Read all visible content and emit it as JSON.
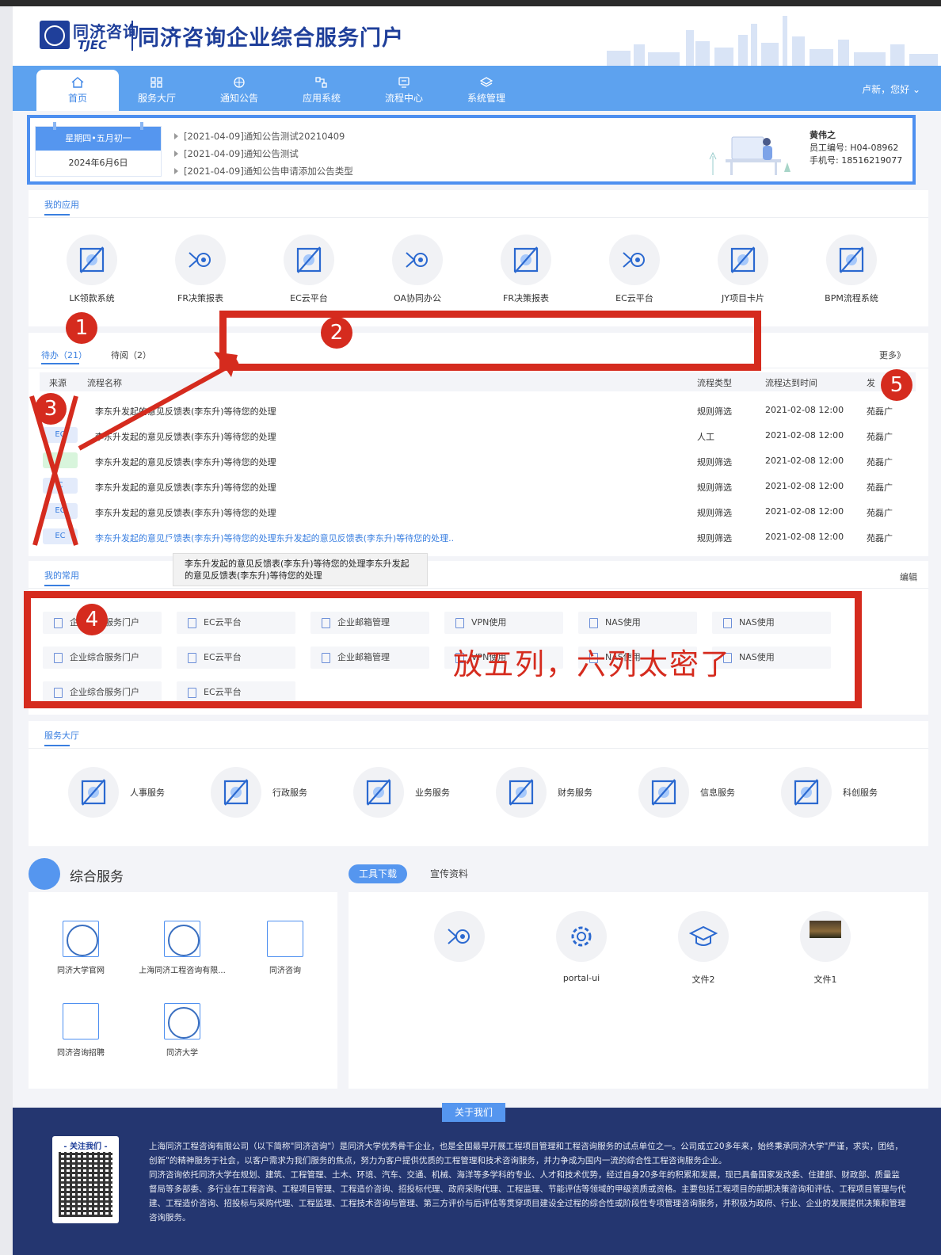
{
  "header": {
    "logo_cn": "同济咨询",
    "logo_en": "TJEC",
    "title": "同济咨询企业综合服务门户"
  },
  "nav": {
    "items": [
      {
        "label": "首页",
        "icon": "home-icon"
      },
      {
        "label": "服务大厅",
        "icon": "grid-icon"
      },
      {
        "label": "通知公告",
        "icon": "globe-icon"
      },
      {
        "label": "应用系统",
        "icon": "apps-icon"
      },
      {
        "label": "流程中心",
        "icon": "flow-icon"
      },
      {
        "label": "系统管理",
        "icon": "layers-icon"
      }
    ],
    "user": "卢新，您好"
  },
  "notice": {
    "weekday": "星期四•五月初一",
    "date": "2024年6月6日",
    "items": [
      "[2021-04-09]通知公告测试20210409",
      "[2021-04-09]通知公告测试",
      "[2021-04-09]通知公告申请添加公告类型"
    ],
    "profile": {
      "name": "黄伟之",
      "emp_no": "员工编号: H04-08962",
      "phone": "手机号: 18516219077"
    }
  },
  "my_apps": {
    "tab": "我的应用",
    "apps": [
      "LK领款系统",
      "FR决策报表",
      "EC云平台",
      "OA协同办公",
      "FR决策报表",
      "EC云平台",
      "JY项目卡片",
      "BPM流程系统"
    ]
  },
  "todo": {
    "tab_todo": "待办（21）",
    "tab_read": "待阅（2）",
    "more": "更多》",
    "headers": {
      "source": "来源",
      "name": "流程名称",
      "type": "流程类型",
      "time": "流程达到时间",
      "initiator": "发"
    },
    "rows": [
      {
        "src": "",
        "name": "李东升发起的意见反馈表(李东升)等待您的处理",
        "type": "规则筛选",
        "time": "2021-02-08 12:00",
        "initiator": "苑磊广"
      },
      {
        "src": "EC",
        "name": "李东升发起的意见反馈表(李东升)等待您的处理",
        "type": "人工",
        "time": "2021-02-08 12:00",
        "initiator": "苑磊广"
      },
      {
        "src": "",
        "name": "李东升发起的意见反馈表(李东升)等待您的处理",
        "type": "规则筛选",
        "time": "2021-02-08 12:00",
        "initiator": "苑磊广"
      },
      {
        "src": "C",
        "name": "李东升发起的意见反馈表(李东升)等待您的处理",
        "type": "规则筛选",
        "time": "2021-02-08 12:00",
        "initiator": "苑磊广"
      },
      {
        "src": "EC",
        "name": "李东升发起的意见反馈表(李东升)等待您的处理",
        "type": "规则筛选",
        "time": "2021-02-08 12:00",
        "initiator": "苑磊广"
      },
      {
        "src": "EC",
        "name": "李东升发起的意见反馈表(李东升)等待您的处理东升发起的意见反馈表(李东升)等待您的处理..",
        "type": "规则筛选",
        "time": "2021-02-08 12:00",
        "initiator": "苑磊广"
      }
    ],
    "tooltip": "李东升发起的意见反馈表(李东升)等待您的处理李东升发起的意见反馈表(李东升)等待您的处理"
  },
  "common": {
    "tab": "我的常用",
    "edit": "编辑",
    "items": [
      "企业综合服务门户",
      "EC云平台",
      "企业邮箱管理",
      "VPN使用",
      "NAS使用",
      "NAS使用",
      "企业综合服务门户",
      "EC云平台",
      "企业邮箱管理",
      "VPN使用",
      "NAS使用",
      "NAS使用",
      "企业综合服务门户",
      "EC云平台"
    ]
  },
  "hall": {
    "tab": "服务大厅",
    "items": [
      "人事服务",
      "行政服务",
      "业务服务",
      "财务服务",
      "信息服务",
      "科创服务"
    ]
  },
  "integrated": {
    "title": "综合服务",
    "tab_active": "工具下载",
    "tab_other": "宣传资料",
    "links": [
      "同济大学官网",
      "上海同济工程咨询有限...",
      "同济咨询",
      "同济咨询招聘",
      "同济大学"
    ],
    "tools": [
      "",
      "portal-ui",
      "文件2",
      "文件1"
    ]
  },
  "footer": {
    "about": "关于我们",
    "follow": "- 关注我们 -",
    "p1": "上海同济工程咨询有限公司（以下简称\"同济咨询\"）是同济大学优秀骨干企业，也是全国最早开展工程项目管理和工程咨询服务的试点单位之一。公司成立20多年来，始终秉承同济大学\"严谨，求实，团结，创新\"的精神服务于社会，以客户需求为我们服务的焦点，努力为客户提供优质的工程管理和技术咨询服务，并力争成为国内一流的综合性工程咨询服务企业。",
    "p2": "同济咨询依托同济大学在规划、建筑、工程管理、土木、环境、汽车、交通、机械、海洋等多学科的专业、人才和技术优势，经过自身20多年的积累和发展，现已具备国家发改委、住建部、财政部、质量监督局等多部委、多行业在工程咨询、工程项目管理、工程造价咨询、招投标代理、政府采购代理、工程监理、节能评估等领域的甲级资质或资格。主要包括工程项目的前期决策咨询和评估、工程项目管理与代建、工程造价咨询、招投标与采购代理、工程监理、工程技术咨询与管理、第三方评价与后评估等贯穿项目建设全过程的综合性或阶段性专项管理咨询服务，并积极为政府、行业、企业的发展提供决策和管理咨询服务。"
  },
  "annotations": {
    "n1": "1",
    "n2": "2",
    "n3": "3",
    "n4": "4",
    "n5": "5",
    "note": "放五列，六列太密了",
    "color": "#d52b1e"
  }
}
